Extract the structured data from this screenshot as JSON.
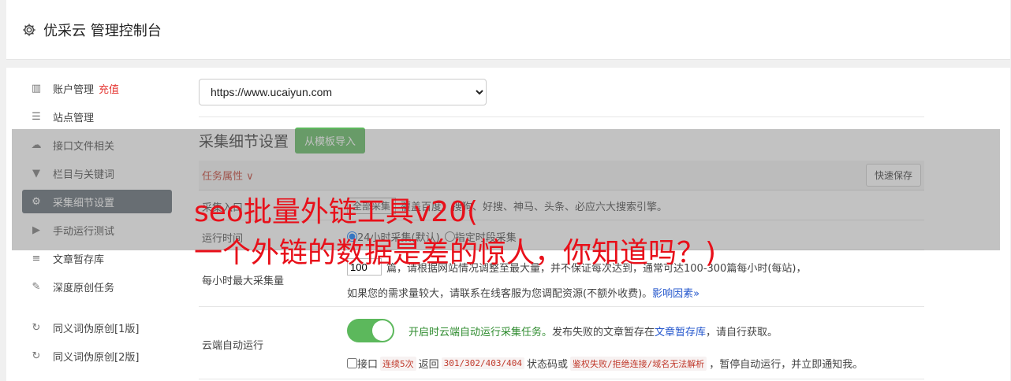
{
  "header": {
    "title": "优采云 管理控制台",
    "icon": "gear-icon"
  },
  "sidebar": {
    "items": [
      {
        "label": "账户管理",
        "extra": "充值",
        "icon": "bar-chart-icon"
      },
      {
        "label": "站点管理",
        "icon": "server-icon"
      },
      {
        "label": "接口文件相关",
        "icon": "cloud-upload-icon"
      },
      {
        "label": "栏目与关键词",
        "icon": "filter-icon"
      },
      {
        "label": "采集细节设置",
        "icon": "gears-icon",
        "active": true
      },
      {
        "label": "手动运行测试",
        "icon": "play-icon"
      },
      {
        "label": "文章暂存库",
        "icon": "database-icon"
      },
      {
        "label": "深度原创任务",
        "icon": "edit-icon"
      },
      {
        "label": "同义词伪原创[1版]",
        "icon": "refresh-icon"
      },
      {
        "label": "同义词伪原创[2版]",
        "icon": "refresh-icon"
      }
    ]
  },
  "main": {
    "site_select": {
      "value": "https://www.ucaiyun.com",
      "options": [
        "https://www.ucaiyun.com"
      ]
    },
    "section_title": "采集细节设置",
    "import_button": "从模板导入",
    "task_attr": "任务属性 ∨",
    "quick_save": "快速保存",
    "rows": {
      "source": {
        "label": "采集入口",
        "button": "全部采集",
        "text": "覆盖百度、搜狗、好搜、神马、头条、必应六大搜索引擎。"
      },
      "runtime": {
        "label": "运行时间",
        "opt1": "24小时采集(默认)",
        "opt2": "指定时段采集"
      },
      "max": {
        "label": "每小时最大采集量",
        "value": "100",
        "text1": "篇，请根据网站情况调整至最大量，并不保证每次达到，通常可达100-300篇每小时(每站)，",
        "text2": "如果您的需求量较大，请联系在线客服为您调配资源(不额外收费)。",
        "link": "影响因素»"
      },
      "cloud": {
        "label": "云端自动运行",
        "text_green": "开启时云端自动运行采集任务。",
        "text_a": "发布失败的文章暂存在",
        "link": "文章暂存库",
        "text_b": "，请自行获取。",
        "check_label": "接口",
        "code1": "连续5次",
        "text_c": "返回",
        "code2": "301/302/403/404",
        "text_d": "状态码或",
        "code3": "鉴权失败/拒绝连接/域名无法解析",
        "text_e": "，暂停自动运行，并立即通知我。"
      }
    }
  },
  "overlay": {
    "line1": "seo批量外链工具v20(",
    "line2": "一个外链的数据是差的惊人，你知道吗？)"
  },
  "colors": {
    "accent_green": "#5cb85c",
    "active_sidebar": "#5c6770",
    "red_text": "#e8101a"
  }
}
